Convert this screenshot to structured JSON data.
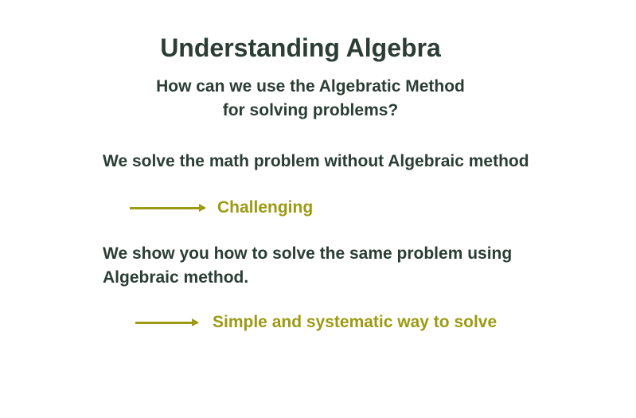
{
  "title": "Understanding Algebra",
  "subtitle": {
    "line1": "How can we use the Algebratic Method",
    "line2": "for solving problems?"
  },
  "points": [
    {
      "statement": "We solve the math problem without Algebraic method",
      "result": "Challenging"
    },
    {
      "statement_line1": "We show you how to solve the same problem using",
      "statement_line2": "Algebraic method.",
      "result": "Simple and systematic way to solve"
    }
  ],
  "icons": {
    "arrow": "right-arrow-icon"
  },
  "colors": {
    "text": "#2b3d35",
    "accent": "#9c9a12",
    "background": "#ffffff"
  }
}
